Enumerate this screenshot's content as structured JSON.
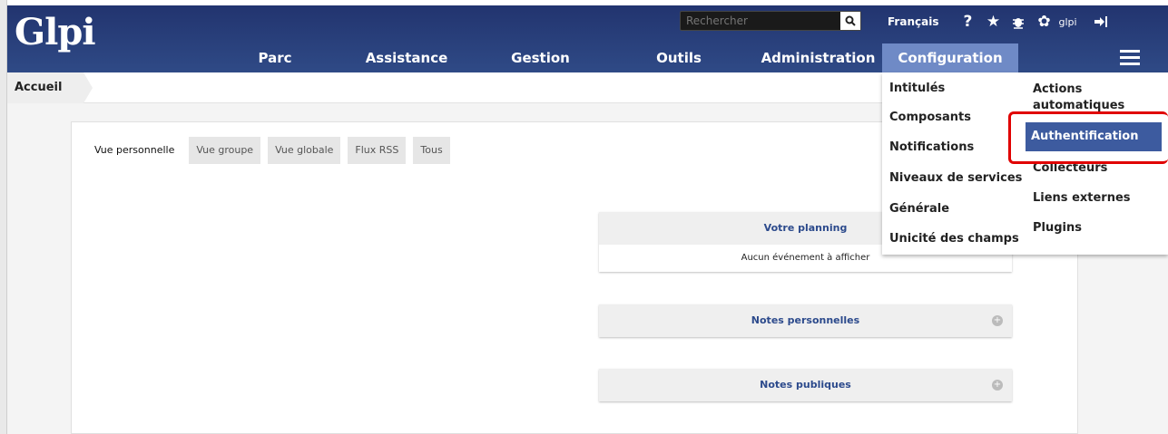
{
  "app": {
    "logo": "Glpi"
  },
  "search": {
    "placeholder": "Rechercher"
  },
  "topbar": {
    "language": "Français",
    "user": "glpi"
  },
  "nav": {
    "items": [
      "Parc",
      "Assistance",
      "Gestion",
      "Outils",
      "Administration",
      "Configuration"
    ],
    "active": "Configuration"
  },
  "breadcrumb": {
    "home": "Accueil"
  },
  "tabs": [
    "Vue personnelle",
    "Vue groupe",
    "Vue globale",
    "Flux RSS",
    "Tous"
  ],
  "boxes": {
    "planning": {
      "title": "Votre planning",
      "body": "Aucun événement à afficher"
    },
    "notes_perso": {
      "title": "Notes personnelles"
    },
    "notes_public": {
      "title": "Notes publiques"
    }
  },
  "config_menu": {
    "col1": [
      "Intitulés",
      "Composants",
      "Notifications",
      "Niveaux de services",
      "Générale",
      "Unicité des champs"
    ],
    "col2": [
      "Actions automatiques",
      "Authentification",
      "Collecteurs",
      "Liens externes",
      "Plugins"
    ],
    "highlighted": "Authentification"
  },
  "colors": {
    "topbar": "#22346f",
    "active_nav": "#6f8ac6",
    "highlight": "#3d5b9f",
    "callout": "#e00000"
  }
}
